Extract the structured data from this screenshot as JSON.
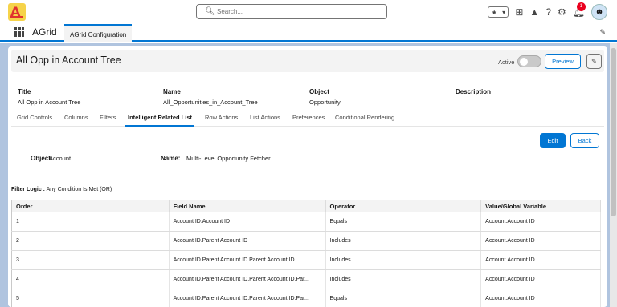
{
  "header": {
    "search_placeholder": "Search...",
    "notification_count": "1"
  },
  "nav": {
    "app_name": "AGrid",
    "tab_label": "AGrid Configuration"
  },
  "record": {
    "title": "All Opp in Account Tree",
    "active_label": "Active",
    "preview_label": "Preview",
    "fields": [
      {
        "label": "Title",
        "value": "All Opp in Account Tree"
      },
      {
        "label": "Name",
        "value": "All_Opportunities_in_Account_Tree"
      },
      {
        "label": "Object",
        "value": "Opportunity"
      },
      {
        "label": "Description",
        "value": ""
      }
    ]
  },
  "tabs": [
    "Grid Controls",
    "Columns",
    "Filters",
    "Intelligent Related List",
    "Row Actions",
    "List Actions",
    "Preferences",
    "Conditional Rendering"
  ],
  "detail": {
    "edit_label": "Edit",
    "back_label": "Back",
    "object_label": "Object:",
    "object_value": "Account",
    "name_label": "Name:",
    "name_value": "Multi-Level Opportunity Fetcher",
    "filter_logic_label": "Filter Logic :",
    "filter_logic_value": "Any Condition Is Met (OR)"
  },
  "table": {
    "headers": [
      "Order",
      "Field Name",
      "Operator",
      "Value/Global Variable"
    ],
    "rows": [
      [
        "1",
        "Account ID.Account ID",
        "Equals",
        "Account.Account ID"
      ],
      [
        "2",
        "Account ID.Parent Account ID",
        "Includes",
        "Account.Account ID"
      ],
      [
        "3",
        "Account ID.Parent Account ID.Parent Account ID",
        "Includes",
        "Account.Account ID"
      ],
      [
        "4",
        "Account ID.Parent Account ID.Parent Account ID.Par...",
        "Includes",
        "Account.Account ID"
      ],
      [
        "5",
        "Account ID.Parent Account ID.Parent Account ID.Par...",
        "Equals",
        "Account.Account ID"
      ]
    ]
  }
}
